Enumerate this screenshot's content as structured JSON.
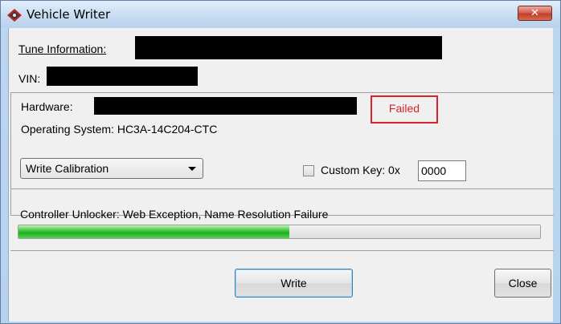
{
  "window": {
    "title": "Vehicle Writer",
    "close_glyph": "✕",
    "icon": "vehicle-writer-app-icon"
  },
  "tune_info": {
    "label": "Tune Information:"
  },
  "vin": {
    "label": "VIN:"
  },
  "hardware": {
    "label": "Hardware:",
    "status": "Failed",
    "status_color": "#d8242e"
  },
  "os": {
    "text": "Operating System: HC3A-14C204-CTC"
  },
  "operation_select": {
    "selected": "Write Calibration"
  },
  "custom_key": {
    "label": "Custom Key: 0x",
    "value": "0000",
    "checked": false
  },
  "status": {
    "message": "Controller Unlocker: Web Exception, Name Resolution Failure"
  },
  "progress": {
    "fraction": 0.52,
    "color": "#2db52f"
  },
  "buttons": {
    "write": "Write",
    "close": "Close"
  }
}
